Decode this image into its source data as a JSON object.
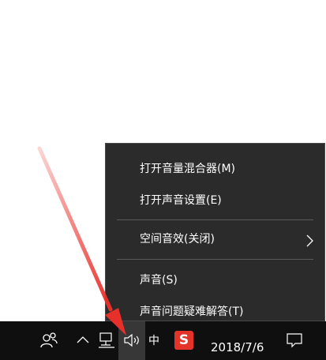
{
  "context_menu": {
    "items": [
      {
        "label": "打开音量混合器(M)"
      },
      {
        "label": "打开声音设置(E)"
      },
      {
        "label": "空间音效(关闭)"
      },
      {
        "label": "声音(S)"
      },
      {
        "label": "声音问题疑难解答(T)"
      }
    ]
  },
  "taskbar": {
    "ime_label": "中",
    "sogou_label": "S",
    "date": "2018/7/6"
  },
  "colors": {
    "menu_bg": "#2b2b2b",
    "taskbar_bg": "#0f0f0f",
    "arrow": "#e8302a",
    "sogou": "#e4342a"
  },
  "icons": [
    "people-icon",
    "chevron-up-icon",
    "network-icon",
    "speaker-icon",
    "sogou-icon",
    "notification-icon",
    "chevron-right-icon"
  ]
}
